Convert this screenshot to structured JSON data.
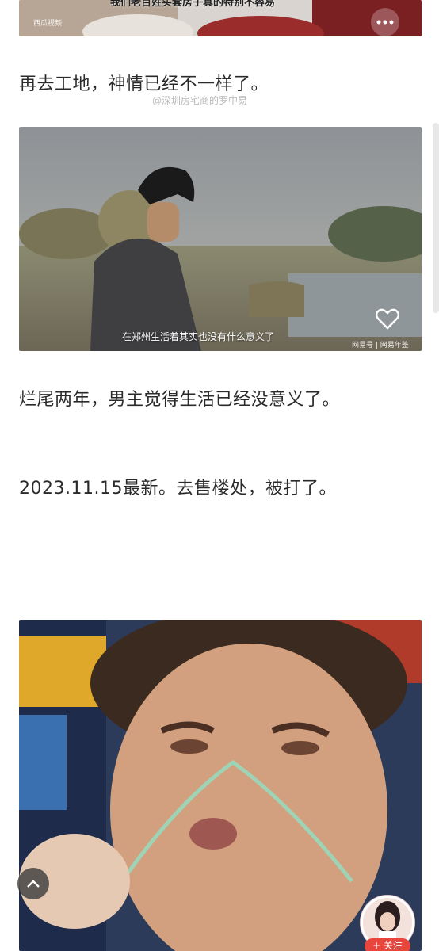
{
  "top_video": {
    "subtitle": "我们老百姓买套房子真的特别不容易",
    "brand": "西瓜视频"
  },
  "watermark": "@深圳房宅商的罗中易",
  "paragraphs": {
    "p1": "再去工地，神情已经不一样了。",
    "p2": "烂尾两年，男主觉得生活已经没意义了。",
    "p3": "2023.11.15最新。去售楼处，被打了。"
  },
  "image2": {
    "caption": "在郑州生活着其实也没有什么意义了",
    "source": "网易号 | 网易年鉴"
  },
  "ui": {
    "follow_label": "+ 关注",
    "back_to_top_icon": "chevron-up-icon"
  },
  "colors": {
    "text": "#2a2a2a",
    "follow_btn": "#e8463c",
    "back_top_bg": "#3c3c3c"
  }
}
